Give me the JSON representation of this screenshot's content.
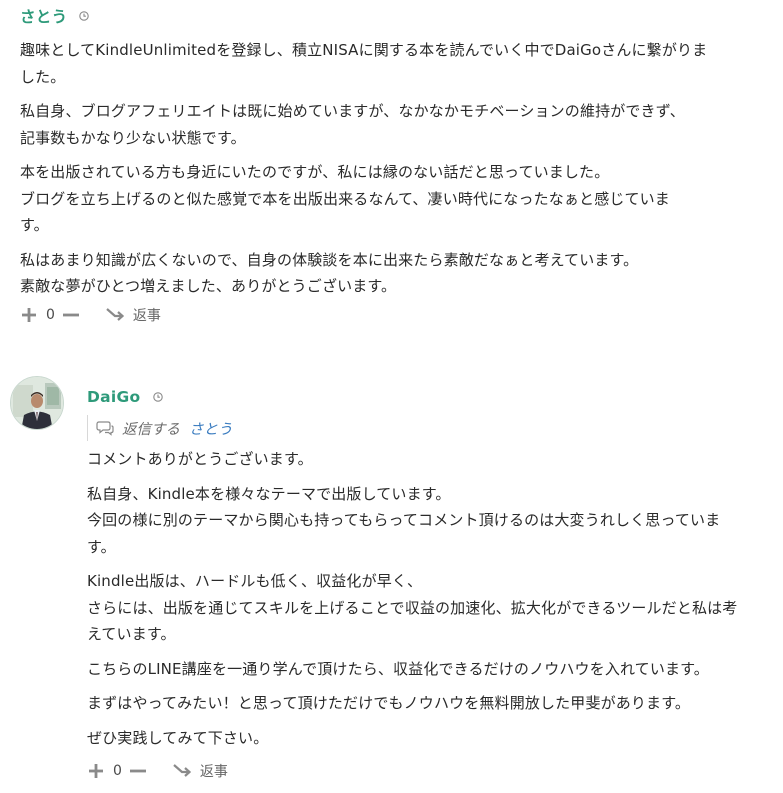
{
  "comments": [
    {
      "author": "さとう",
      "paragraphs": [
        [
          "趣味としてKindleUnlimitedを登録し、積立NISAに関する本を読んでいく中でDaiGoさんに繋がりま",
          "した。"
        ],
        [
          "私自身、ブログアフェリエイトは既に始めていますが、なかなかモチベーションの維持ができず、",
          "記事数もかなり少ない状態です。"
        ],
        [
          "本を出版されている方も身近にいたのですが、私には縁のない話だと思っていました。",
          "ブログを立ち上げるのと似た感覚で本を出版出来るなんて、凄い時代になったなぁと感じていま",
          "す。"
        ],
        [
          "私はあまり知識が広くないので、自身の体験談を本に出来たら素敵だなぁと考えています。",
          "素敵な夢がひとつ増えました、ありがとうございます。"
        ]
      ],
      "vote_count": "0",
      "reply_label": "返事"
    },
    {
      "author": "DaiGo",
      "reply_to_label": "返信する",
      "reply_to_name": "さとう",
      "paragraphs": [
        [
          "コメントありがとうございます。"
        ],
        [
          "私自身、Kindle本を様々なテーマで出版しています。",
          "今回の様に別のテーマから関心も持ってもらってコメント頂けるのは大変うれしく思っていま",
          "す。"
        ],
        [
          "Kindle出版は、ハードルも低く、収益化が早く、",
          "さらには、出版を通じてスキルを上げることで収益の加速化、拡大化ができるツールだと私は考",
          "えています。"
        ],
        [
          "こちらのLINE講座を一通り学んで頂けたら、収益化できるだけのノウハウを入れています。"
        ],
        [
          "まずはやってみたい！と思って頂けただけでもノウハウを無料開放した甲斐があります。"
        ],
        [
          "ぜひ実践してみて下さい。"
        ]
      ],
      "vote_count": "0",
      "reply_label": "返事"
    }
  ],
  "colors": {
    "author": "#2e9a7a",
    "reply_to_name": "#3a7cc0",
    "text": "#2a2a2a",
    "icon": "#8a8a8a"
  },
  "icons": {
    "timestamp": "clock-icon",
    "upvote": "plus-icon",
    "downvote": "minus-icon",
    "reply": "reply-arrow-icon",
    "reply_to": "comment-bubble-icon"
  }
}
